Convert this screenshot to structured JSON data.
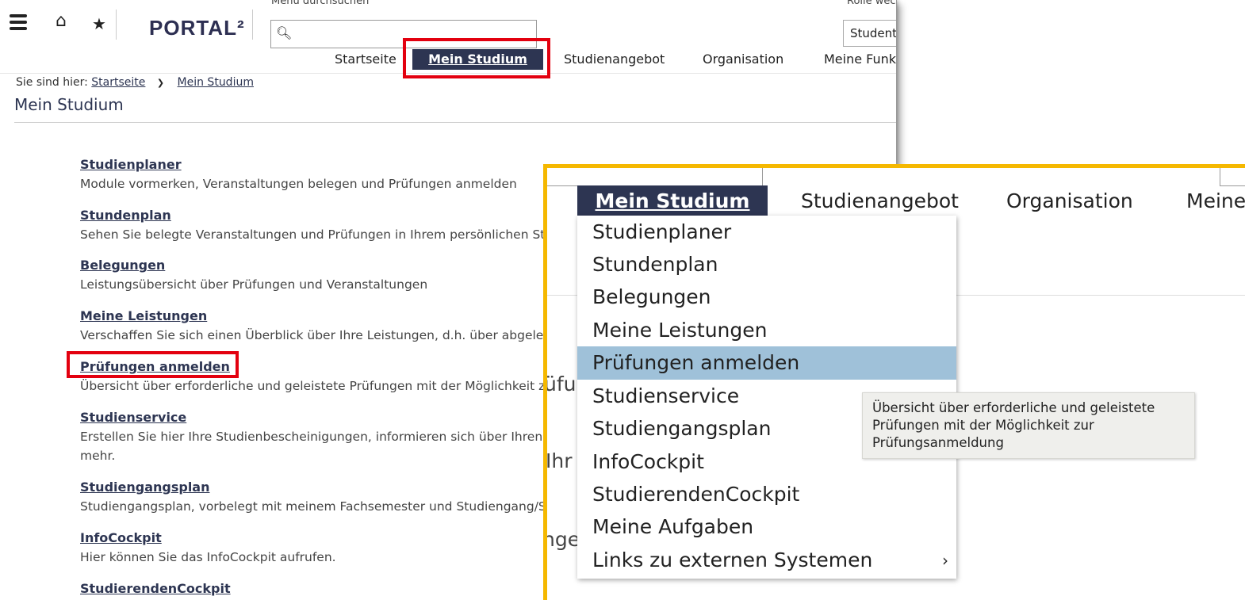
{
  "header": {
    "logo": "PORTAL²",
    "search_caption": "Menü durchsuchen",
    "search_value": "",
    "role_caption": "Rolle wechseln",
    "role_value": "Student"
  },
  "nav": {
    "items": [
      "Startseite",
      "Mein Studium",
      "Studienangebot",
      "Organisation",
      "Meine Funkt"
    ],
    "active": "Mein Studium"
  },
  "breadcrumb": {
    "prefix": "Sie sind hier:",
    "items": [
      "Startseite",
      "Mein Studium"
    ]
  },
  "page_title": "Mein Studium",
  "entries": [
    {
      "title": "Studienplaner",
      "desc": "Module vormerken, Veranstaltungen belegen und Prüfungen anmelden"
    },
    {
      "title": "Stundenplan",
      "desc": "Sehen Sie belegte Veranstaltungen und Prüfungen in Ihrem persönlichen Stur"
    },
    {
      "title": "Belegungen",
      "desc": "Leistungsübersicht über Prüfungen und Veranstaltungen"
    },
    {
      "title": "Meine Leistungen",
      "desc": "Verschaffen Sie sich einen Überblick über Ihre Leistungen, d.h. über abgelegte"
    },
    {
      "title": "Prüfungen anmelden",
      "desc": "Übersicht über erforderliche und geleistete Prüfungen mit der Möglichkeit zur"
    },
    {
      "title": "Studienservice",
      "desc": "Erstellen Sie hier Ihre Studienbescheinigungen, informieren sich über Ihren R",
      "desc2": "mehr."
    },
    {
      "title": "Studiengangsplan",
      "desc": "Studiengangsplan, vorbelegt mit meinem Fachsemester und Studiengang/Stu"
    },
    {
      "title": "InfoCockpit",
      "desc": "Hier können Sie das InfoCockpit aufrufen."
    },
    {
      "title": "StudierendenCockpit",
      "desc": ""
    }
  ],
  "zoom": {
    "nav": [
      "Mein Studium",
      "Studienangebot",
      "Organisation",
      "Meine"
    ],
    "bg_fragments": [
      "üfu",
      "Ihr",
      "nger"
    ],
    "menu": [
      "Studienplaner",
      "Stundenplan",
      "Belegungen",
      "Meine Leistungen",
      "Prüfungen anmelden",
      "Studienservice",
      "Studiengangsplan",
      "InfoCockpit",
      "StudierendenCockpit",
      "Meine Aufgaben",
      "Links zu externen Systemen"
    ],
    "highlighted": "Prüfungen anmelden",
    "submenu_arrow": "›",
    "tooltip": "Übersicht über erforderliche und geleistete Prüfungen mit der Möglichkeit zur Prüfungsanmeldung"
  },
  "colors": {
    "brand": "#2d3552",
    "highlight_box": "#e3000f",
    "zoom_border": "#f5b800",
    "menu_hover": "#9fc1d9"
  }
}
